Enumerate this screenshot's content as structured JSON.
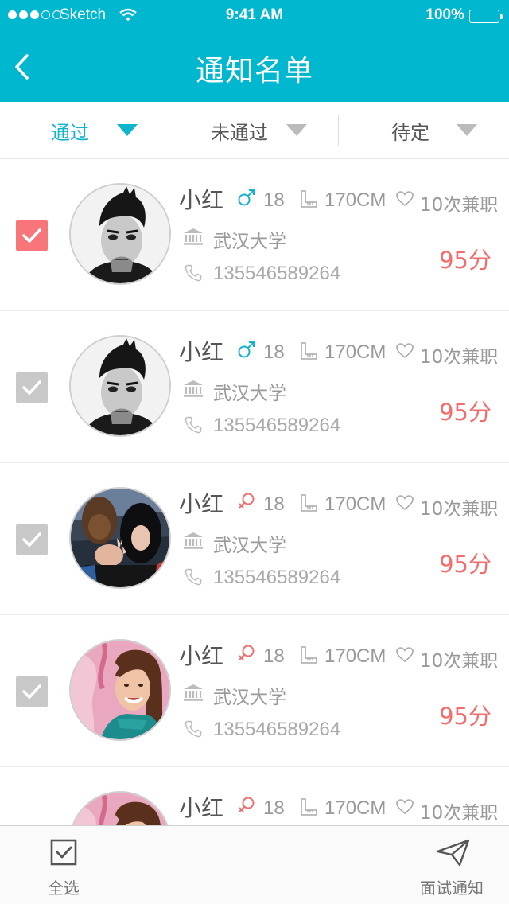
{
  "status_bar": {
    "carrier": "Sketch",
    "time": "9:41 AM",
    "battery": "100%"
  },
  "nav": {
    "title": "通知名单"
  },
  "filters": [
    {
      "label": "通过",
      "active": true
    },
    {
      "label": "未通过",
      "active": false
    },
    {
      "label": "待定",
      "active": false
    }
  ],
  "candidates": [
    {
      "name": "小红",
      "gender": "male",
      "age": "18",
      "height": "170CM",
      "jobs": "10次兼职",
      "school": "武汉大学",
      "phone": "135546589264",
      "score": "95分",
      "checked": true,
      "avatar": "man-avatar"
    },
    {
      "name": "小红",
      "gender": "male",
      "age": "18",
      "height": "170CM",
      "jobs": "10次兼职",
      "school": "武汉大学",
      "phone": "135546589264",
      "score": "95分",
      "checked": false,
      "avatar": "man-avatar"
    },
    {
      "name": "小红",
      "gender": "female",
      "age": "18",
      "height": "170CM",
      "jobs": "10次兼职",
      "school": "武汉大学",
      "phone": "135546589264",
      "score": "95分",
      "checked": false,
      "avatar": "party-avatar"
    },
    {
      "name": "小红",
      "gender": "female",
      "age": "18",
      "height": "170CM",
      "jobs": "10次兼职",
      "school": "武汉大学",
      "phone": "135546589264",
      "score": "95分",
      "checked": false,
      "avatar": "woman-avatar"
    },
    {
      "name": "小红",
      "gender": "female",
      "age": "18",
      "height": "170CM",
      "jobs": "10次兼职",
      "school": "",
      "phone": "",
      "score": "",
      "checked": false,
      "avatar": "woman-avatar"
    }
  ],
  "toolbar": {
    "select_all": "全选",
    "interview_notify": "面试通知"
  },
  "colors": {
    "header": "#00b7d0",
    "accent": "#10b5cc",
    "score": "#f36d6d",
    "checked": "#f8767a",
    "unchecked": "#c8c8c8"
  }
}
